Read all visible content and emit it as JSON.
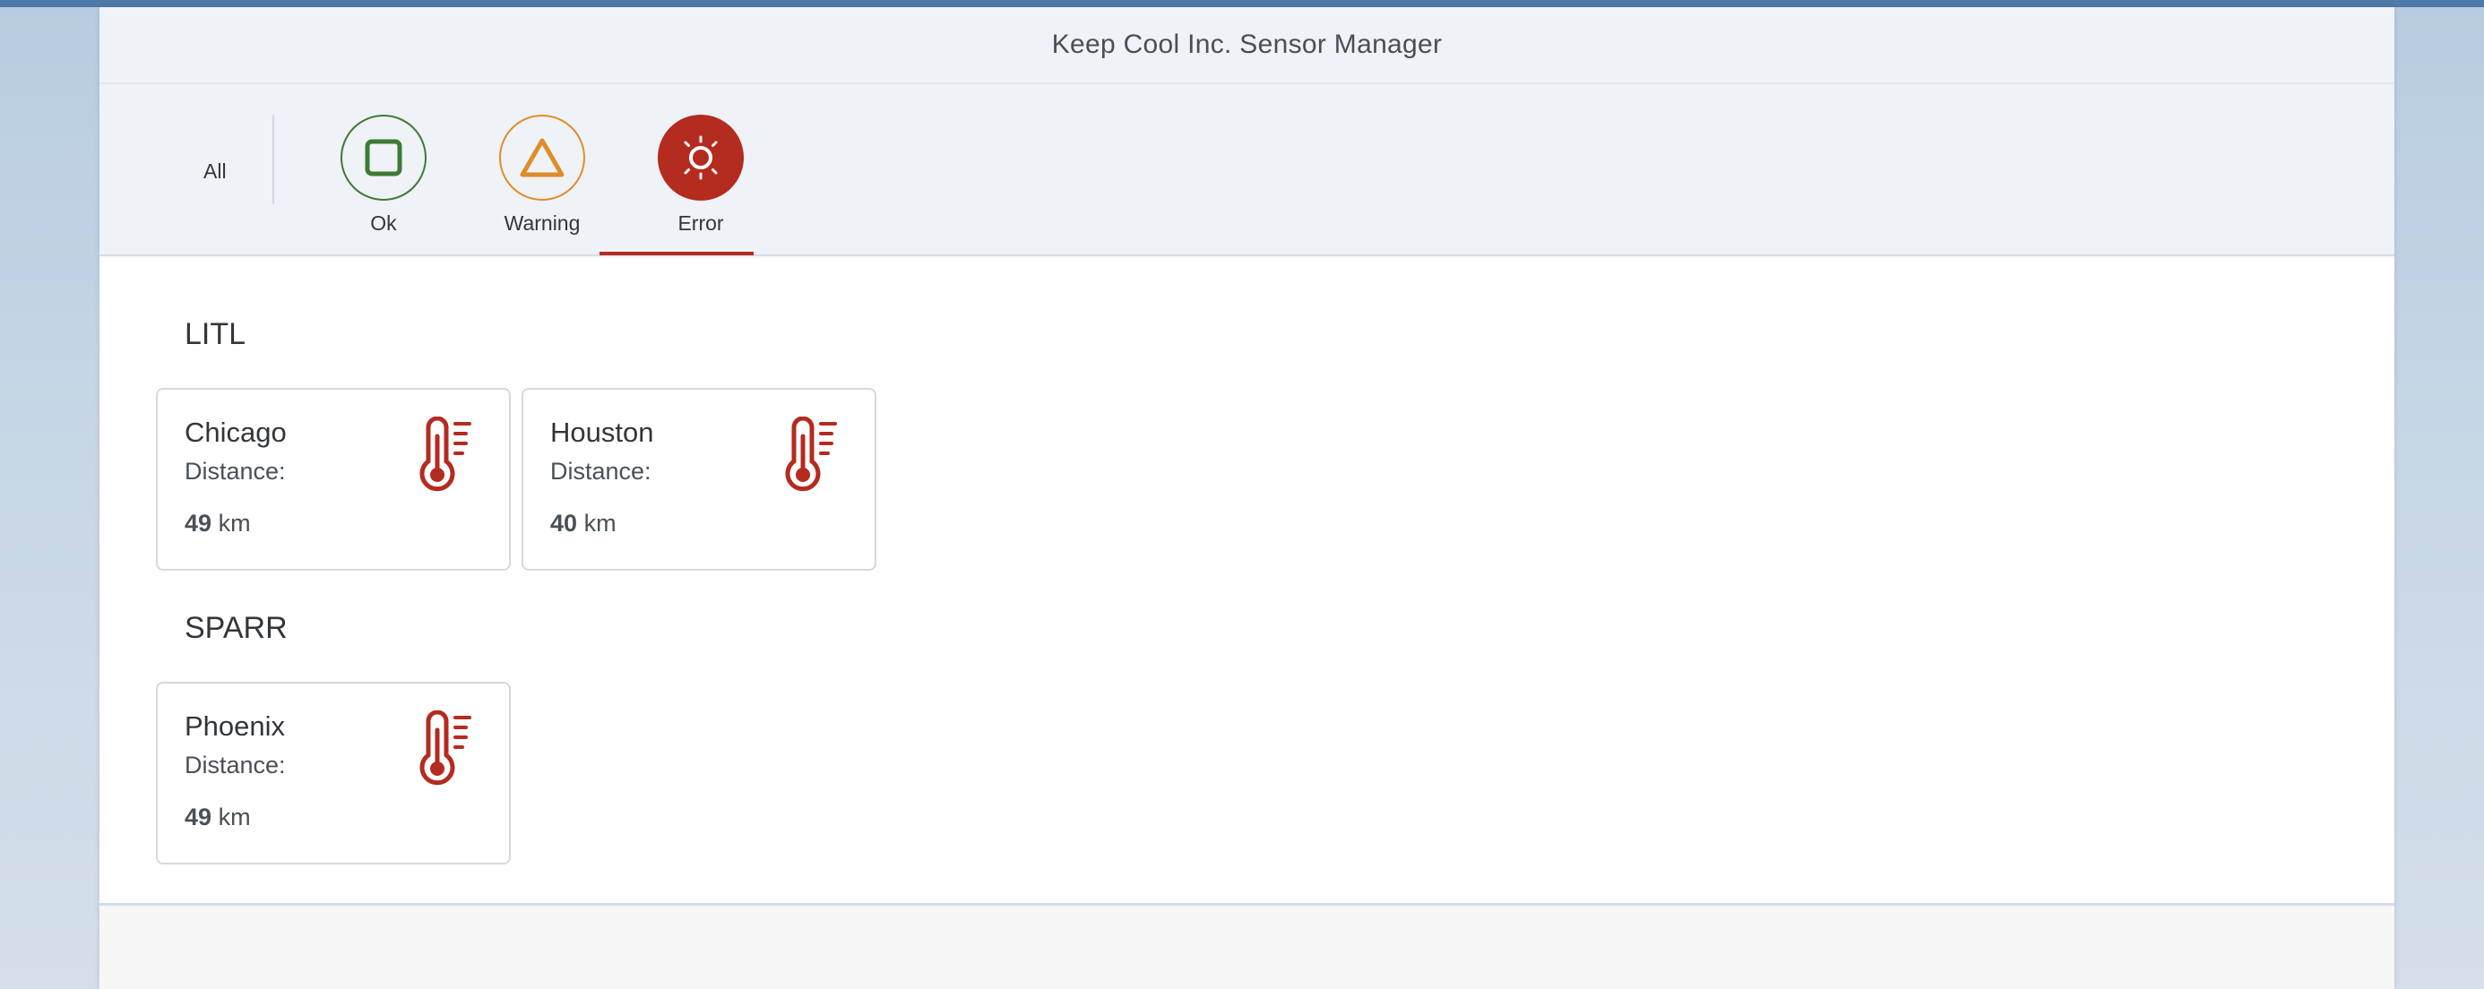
{
  "header": {
    "title": "Keep Cool Inc. Sensor Manager"
  },
  "filters": {
    "all_label": "All",
    "tabs": [
      {
        "label": "Ok",
        "icon": "square-icon",
        "color": "#3f7a33"
      },
      {
        "label": "Warning",
        "icon": "triangle-icon",
        "color": "#df8d2a"
      },
      {
        "label": "Error",
        "icon": "sun-icon",
        "color": "#b42b1f",
        "selected": true
      }
    ]
  },
  "groups": [
    {
      "name": "LITL",
      "sensors": [
        {
          "city": "Chicago",
          "distance_label": "Distance:",
          "distance": "49",
          "unit": "km",
          "icon": "thermometer-icon"
        },
        {
          "city": "Houston",
          "distance_label": "Distance:",
          "distance": "40",
          "unit": "km",
          "icon": "thermometer-icon"
        }
      ]
    },
    {
      "name": "SPARR",
      "sensors": [
        {
          "city": "Phoenix",
          "distance_label": "Distance:",
          "distance": "49",
          "unit": "km",
          "icon": "thermometer-icon"
        }
      ]
    }
  ],
  "colors": {
    "error": "#b42b1f",
    "ok": "#3f7a33",
    "warning": "#df8d2a"
  }
}
